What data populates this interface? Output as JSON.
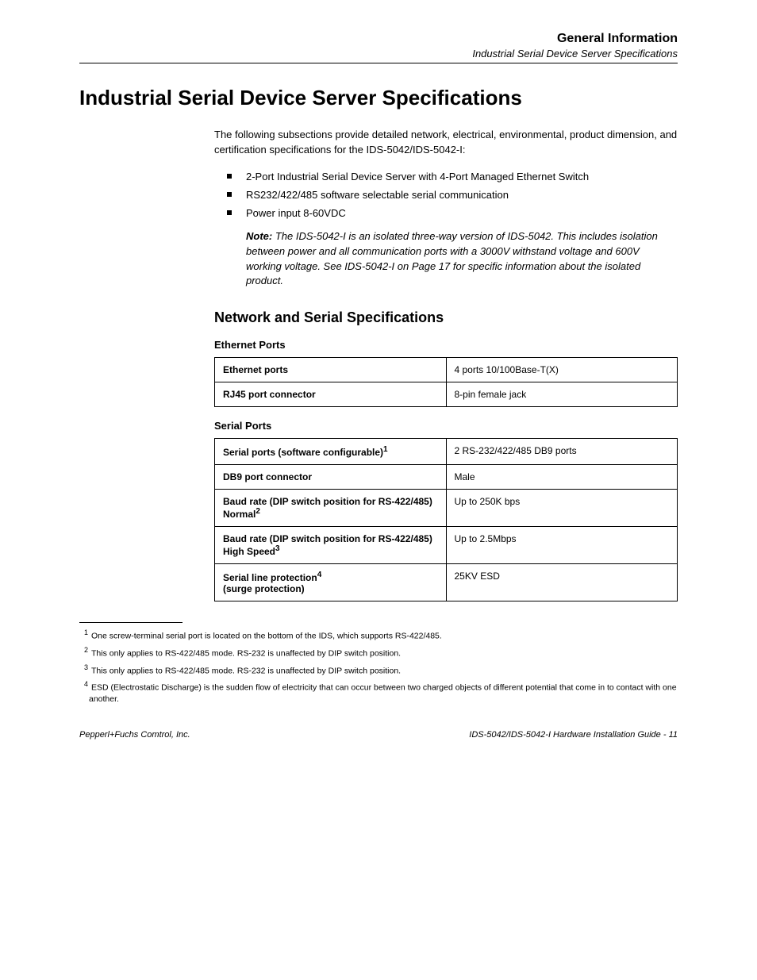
{
  "header": {
    "title": "General Information",
    "subtitle": "Industrial Serial Device Server Specifications"
  },
  "section_title": "Industrial Serial Device Server Specifications",
  "intro": {
    "lead": "The following subsections provide detailed network, electrical, environmental, product dimension, and certification specifications for the IDS-5042/IDS-5042-I:",
    "bullets": [
      "2-Port Industrial Serial Device Server with 4-Port Managed Ethernet Switch",
      "RS232/422/485 software selectable serial communication",
      "Power input 8-60VDC"
    ]
  },
  "note": {
    "label": "Note:",
    "text": "The IDS-5042-I is an isolated three-way version of IDS-5042. This includes isolation between power and all communication ports with a 3000V withstand voltage and 600V working voltage. See IDS-5042-I on Page 17 for specific information about the isolated product."
  },
  "network_title": "Network and Serial Specifications",
  "ethernet_sub": "Ethernet Ports",
  "ethernet_table": [
    {
      "key": "Ethernet ports",
      "val": "4 ports 10/100Base-T(X)"
    },
    {
      "key": "RJ45 port connector",
      "val": "8-pin female jack"
    }
  ],
  "serial_sub": "Serial Ports",
  "serial_table": [
    {
      "key": "Serial ports (software configurable)",
      "sup": "1",
      "val": "2 RS-232/422/485 DB9 ports"
    },
    {
      "key": "DB9 port connector",
      "val": "Male"
    },
    {
      "key": "Baud rate (DIP switch position for RS-422/485) Normal",
      "sup": "2",
      "val": "Up to 250K bps"
    },
    {
      "key": "Baud rate (DIP switch position for RS-422/485) High Speed",
      "sup": "3",
      "val": "Up to 2.5Mbps"
    },
    {
      "key": "Serial line protection",
      "sup": "4",
      "cont": "(surge protection)",
      "val": "25KV ESD"
    }
  ],
  "footnotes": [
    {
      "n": "1",
      "text": "One screw-terminal serial port is located on the bottom of the IDS, which supports RS-422/485."
    },
    {
      "n": "2",
      "text": "This only applies to RS-422/485 mode. RS-232 is unaffected by DIP switch position."
    },
    {
      "n": "3",
      "text": "This only applies to RS-422/485 mode. RS-232 is unaffected by DIP switch position."
    },
    {
      "n": "4",
      "text": "ESD (Electrostatic Discharge) is the sudden flow of electricity that can occur between two charged objects of different potential that come in to contact with one another."
    }
  ],
  "footer": {
    "left": "Pepperl+Fuchs Comtrol, Inc.",
    "right": "IDS-5042/IDS-5042-I Hardware Installation Guide - 11"
  }
}
